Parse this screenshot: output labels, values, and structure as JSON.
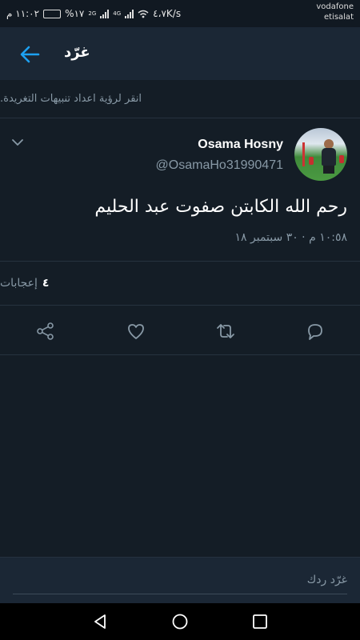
{
  "status_bar": {
    "time": "١١:٠٢ م",
    "battery": "%١٧",
    "network_2g": "2G",
    "network_4g": "4G",
    "speed": "٤،٧K/s",
    "carrier_line1": "vodafone",
    "carrier_line2": "etisalat"
  },
  "header": {
    "title": "غرّد"
  },
  "notify_prompt": "انقر لرؤية اعداد تنبيهات التغريدة.",
  "tweet": {
    "display_name": "Osama Hosny",
    "handle": "@OsamaHo31990471",
    "text": "رحم الله الكابتن صفوت عبد الحليم",
    "timestamp": "١٠:٥٨ م · ٣٠ سبتمبر ١٨"
  },
  "likes": {
    "count": "٤",
    "label": "إعجابات"
  },
  "actions": [
    "reply-icon",
    "retweet-icon",
    "like-icon",
    "share-icon"
  ],
  "reply": {
    "placeholder": "غرّد ردك"
  },
  "colors": {
    "background": "#141d26",
    "header": "#1b2735",
    "accent": "#1da1f2",
    "secondary_text": "#8899a6"
  }
}
